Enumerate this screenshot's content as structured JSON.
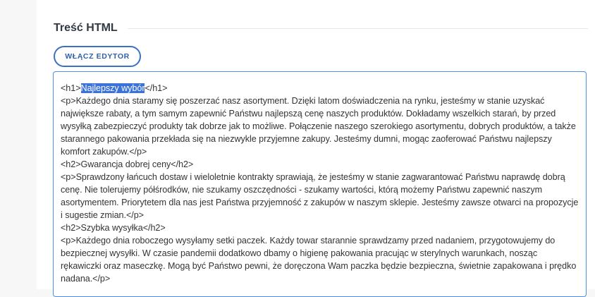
{
  "section": {
    "title": "Treść HTML"
  },
  "editor_button": {
    "label": "WŁĄCZ EDYTOR"
  },
  "content": {
    "h1_open": "<h1>",
    "h1_selected": "Najlepszy wybór",
    "h1_close": "</h1>",
    "p1": "<p>Każdego dnia staramy się poszerzać nasz asortyment. Dzięki latom doświadczenia na rynku, jesteśmy w stanie uzyskać największe rabaty, a tym samym zapewnić Państwu najlepszą cenę naszych produktów. Dokładamy wszelkich starań, by przed wysyłką zabezpieczyć produkty tak dobrze jak to możliwe. Połączenie naszego szerokiego asortymentu, dobrych produktów, a także starannego pakowania przekłada się na niezwykle przyjemne zakupy. Jesteśmy dumni, mogąc zaoferować Państwu najlepszy komfort zakupów.</p>",
    "h2_1": "<h2>Gwarancja dobrej ceny</h2>",
    "p2": "<p>Sprawdzony łańcuch dostaw i wieloletnie kontrakty sprawiają, że jesteśmy w stanie zagwarantować Państwu naprawdę dobrą cenę. Nie tolerujemy półśrodków, nie szukamy oszczędności - szukamy wartości, którą możemy Państwu zapewnić naszym asortymentem. Priorytetem dla nas jest Państwa przyjemność z zakupów w naszym sklepie. Jesteśmy zawsze otwarci na propozycje i sugestie zmian.</p>",
    "h2_2": "<h2>Szybka wysyłka</h2>",
    "p3": "<p>Każdego dnia roboczego wysyłamy setki paczek. Każdy towar starannie sprawdzamy przed nadaniem, przygotowujemy do bezpiecznej wysyłki. W czasie pandemii dodatkowo dbamy o higienę pakowania pracując w sterylnych warunkach, nosząc rękawiczki oraz maseczkę. Mogą być Państwo pewni, że doręczona Wam paczka będzie bezpieczna, świetnie zapakowana i prędko nadana.</p>"
  },
  "colors": {
    "accent": "#3a70c6",
    "selection": "#3b73d9",
    "focus_border": "#4a90e2"
  }
}
